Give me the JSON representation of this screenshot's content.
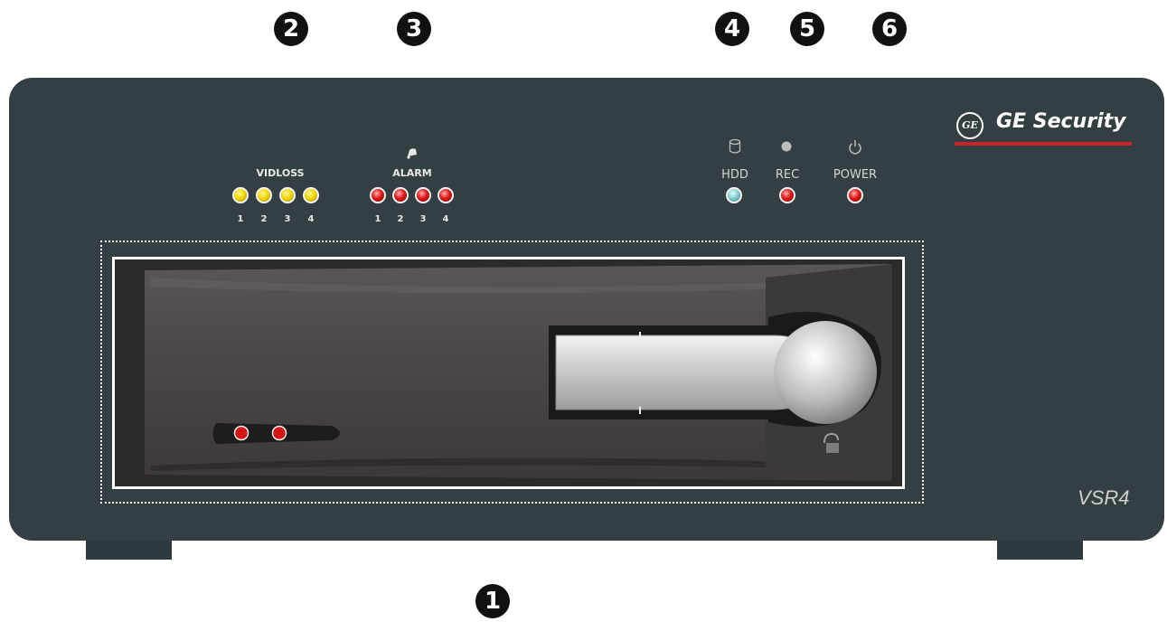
{
  "callouts": [
    "2",
    "3",
    "4",
    "5",
    "6",
    "1"
  ],
  "brand": {
    "mark": "GE",
    "name": "GE Security",
    "underline_color": "#d0202a"
  },
  "model": "VSR4",
  "vidloss": {
    "label": "VIDLOSS",
    "led_color": "yellow",
    "numbers": [
      "1",
      "2",
      "3",
      "4"
    ]
  },
  "alarm": {
    "label": "ALARM",
    "led_color": "red",
    "icon": "bell-icon",
    "numbers": [
      "1",
      "2",
      "3",
      "4"
    ]
  },
  "status": {
    "hdd": {
      "label": "HDD",
      "icon": "disk-icon",
      "led_color": "cyan"
    },
    "rec": {
      "label": "REC",
      "icon": "record-dot-icon",
      "led_color": "red"
    },
    "power": {
      "label": "POWER",
      "icon": "power-icon",
      "led_color": "red"
    }
  },
  "drive_bay": {
    "indicator_leds": 2,
    "lock_icon": "unlock-icon"
  },
  "colors": {
    "panel": "#343f43",
    "yellow_led": "#f5d800",
    "red_led": "#e01818",
    "hdd_led": "#7fc9cc"
  }
}
